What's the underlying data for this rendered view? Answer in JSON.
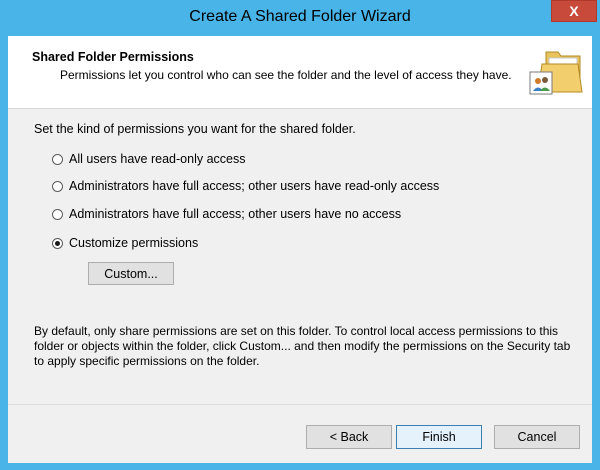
{
  "window": {
    "title": "Create A Shared Folder Wizard",
    "close_label": "X"
  },
  "header": {
    "title": "Shared Folder Permissions",
    "description": "Permissions let you control who can see the folder and the level of access they have.",
    "icon": "shared-folder-icon"
  },
  "body": {
    "instruction": "Set the kind of permissions you want for the shared folder.",
    "options": [
      {
        "label": "All users have read-only access",
        "selected": false
      },
      {
        "label": "Administrators have full access; other users have read-only access",
        "selected": false
      },
      {
        "label": "Administrators have full access; other users have no access",
        "selected": false
      },
      {
        "label": "Customize permissions",
        "selected": true
      }
    ],
    "custom_button": "Custom...",
    "info_text": "By default, only share permissions are set on this folder. To control local access permissions to this folder or objects within the folder, click Custom... and then modify the permissions on the Security tab to apply specific permissions on the folder."
  },
  "footer": {
    "back_label": "< Back",
    "finish_label": "Finish",
    "cancel_label": "Cancel"
  },
  "colors": {
    "frame": "#49b4e8",
    "close": "#c74a3b",
    "client_bg": "#f0f0f0",
    "header_bg": "#ffffff"
  }
}
